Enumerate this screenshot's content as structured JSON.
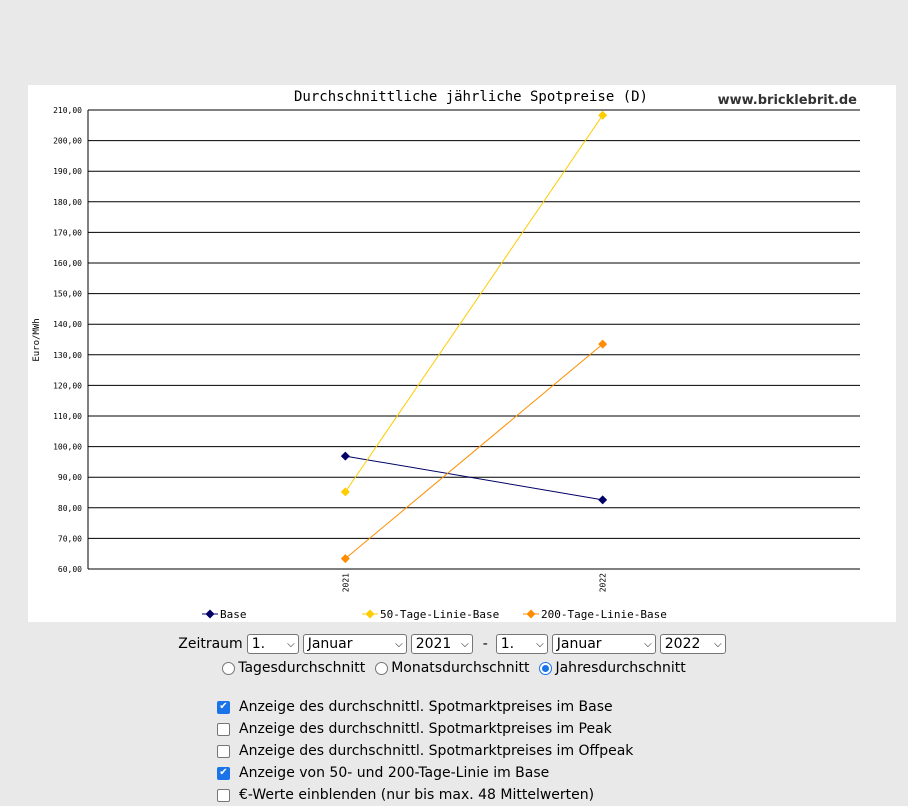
{
  "chart_data": {
    "type": "line",
    "title": "Durchschnittliche jährliche Spotpreise (D)",
    "watermark": "www.bricklebrit.de",
    "ylabel": "Euro/MWh",
    "categories": [
      "2021",
      "2022"
    ],
    "ylim": [
      60,
      210
    ],
    "y_ticks": [
      "210,00",
      "200,00",
      "190,00",
      "180,00",
      "170,00",
      "160,00",
      "150,00",
      "140,00",
      "130,00",
      "120,00",
      "110,00",
      "100,00",
      "90,00",
      "80,00",
      "70,00",
      "60,00"
    ],
    "grid": true,
    "legend_placement": "bottom",
    "series": [
      {
        "name": "Base",
        "values": [
          96.9,
          82.6
        ],
        "color": "#000066"
      },
      {
        "name": "50-Tage-Linie-Base",
        "values": [
          85.2,
          208.3
        ],
        "color": "#ffcc00"
      },
      {
        "name": "200-Tage-Linie-Base",
        "values": [
          63.4,
          133.5
        ],
        "color": "#ff8c00"
      }
    ]
  },
  "controls": {
    "zeitraum_label": "Zeitraum",
    "from_day": "1.",
    "from_month": "Januar",
    "from_year": "2021",
    "separator": "-",
    "to_day": "1.",
    "to_month": "Januar",
    "to_year": "2022",
    "radios": [
      {
        "label": "Tagesdurchschnitt",
        "checked": false
      },
      {
        "label": "Monatsdurchschnitt",
        "checked": false
      },
      {
        "label": "Jahresdurchschnitt",
        "checked": true
      }
    ],
    "checkboxes": [
      {
        "label": "Anzeige des durchschnittl. Spotmarktpreises im Base",
        "checked": true
      },
      {
        "label": "Anzeige des durchschnittl. Spotmarktpreises im Peak",
        "checked": false
      },
      {
        "label": "Anzeige des durchschnittl. Spotmarktpreises im Offpeak",
        "checked": false
      },
      {
        "label": "Anzeige von 50- und 200-Tage-Linie im Base",
        "checked": true
      },
      {
        "label": "€-Werte einblenden (nur bis max. 48 Mittelwerten)",
        "checked": false
      }
    ]
  }
}
